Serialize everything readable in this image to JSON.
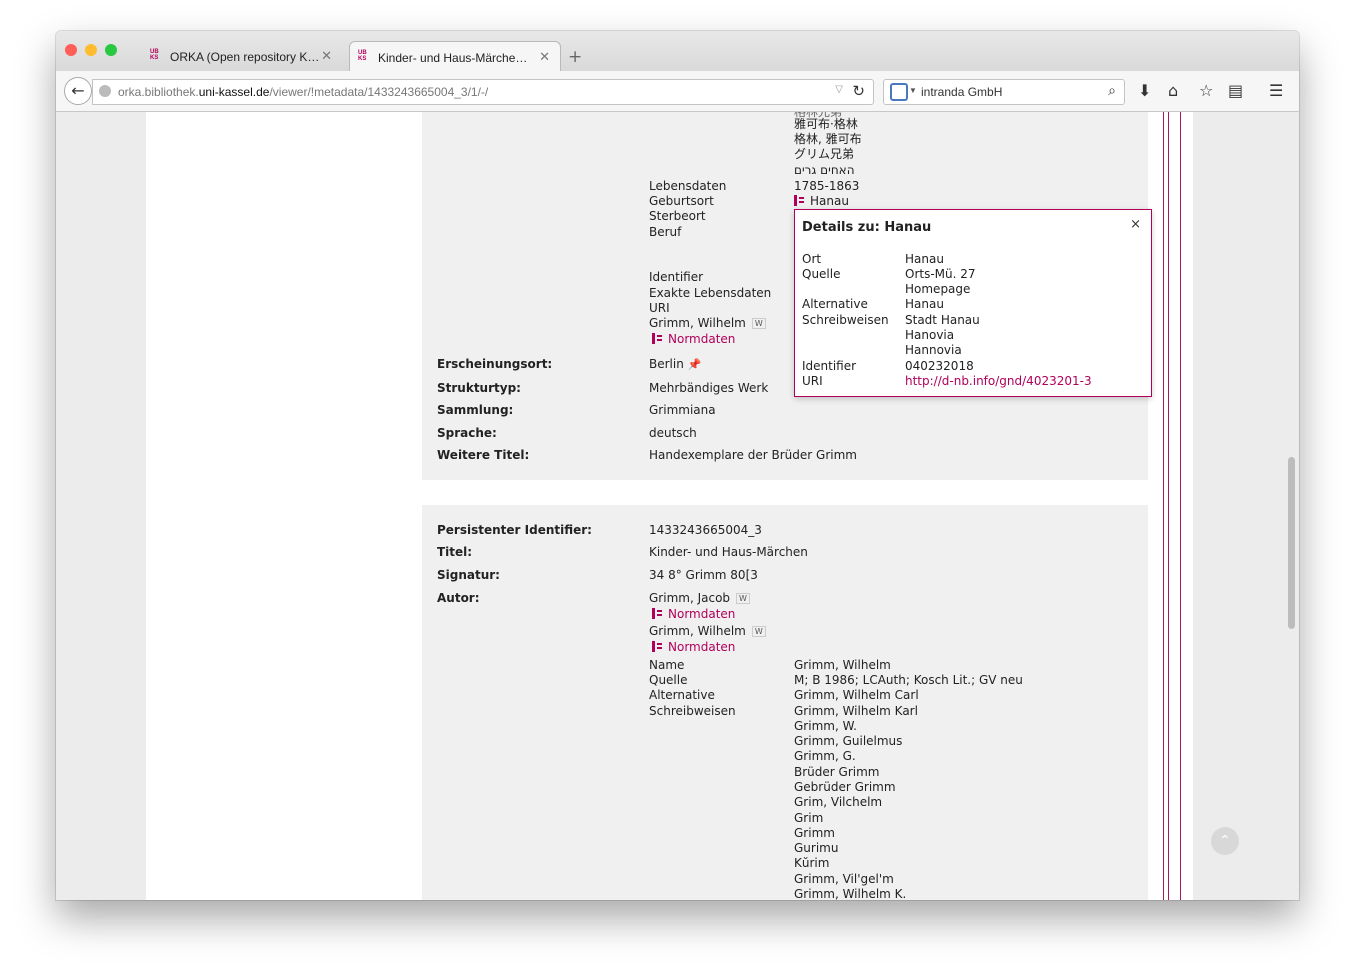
{
  "browser": {
    "tabs": [
      {
        "title": "ORKA (Open repository Kas...",
        "favicon": "ub-kassel-favicon"
      },
      {
        "title": "Kinder- und Haus-Märchen ...",
        "favicon": "ub-kassel-favicon"
      }
    ],
    "url": {
      "prefix": "orka.bibliothek.",
      "host": "uni-kassel.de",
      "path": "/viewer/!metadata/1433243665004_3/1/-/"
    },
    "search": {
      "engine": "intranda GmbH"
    },
    "colors": {
      "close": "#ff5f57",
      "minimize": "#febc2e",
      "zoom": "#28c840"
    }
  },
  "section1": {
    "alt_names_tail": [
      "雅可布·格林",
      "格林, 雅可布",
      "グリム兄弟",
      "האחים גרים"
    ],
    "lebensdaten": {
      "label": "Lebensdaten",
      "value": "1785-1863"
    },
    "geburtsort": {
      "label": "Geburtsort",
      "value": "Hanau"
    },
    "sterbeort_label": "Sterbeort",
    "beruf_label": "Beruf",
    "identifier_label": "Identifier",
    "exakte_label": "Exakte Lebensdaten",
    "uri_label": "URI",
    "person2": "Grimm, Wilhelm",
    "normdaten": "Normdaten",
    "rows": [
      {
        "label": "Erscheinungsort:",
        "value": "Berlin"
      },
      {
        "label": "Strukturtyp:",
        "value": "Mehrbändiges Werk"
      },
      {
        "label": "Sammlung:",
        "value": "Grimmiana"
      },
      {
        "label": "Sprache:",
        "value": "deutsch"
      },
      {
        "label": "Weitere Titel:",
        "value": "Handexemplare der Brüder Grimm"
      }
    ]
  },
  "popup": {
    "title": "Details zu: Hanau",
    "close": "×",
    "ort_label": "Ort",
    "ort": "Hanau",
    "quelle_label": "Quelle",
    "quelle": [
      "Orts-Mü. 27",
      "Homepage"
    ],
    "alt_label": [
      "Alternative",
      "Schreibweisen"
    ],
    "alt": [
      "Hanau",
      "Stadt Hanau",
      "Hanovia",
      "Hannovia"
    ],
    "identifier_label": "Identifier",
    "identifier": "040232018",
    "uri_label": "URI",
    "uri": "http://d-nb.info/gnd/4023201-3"
  },
  "section2": {
    "rows": [
      {
        "label": "Persistenter Identifier:",
        "value": "1433243665004_3"
      },
      {
        "label": "Titel:",
        "value": "Kinder- und Haus-Märchen"
      },
      {
        "label": "Signatur:",
        "value": "34 8° Grimm 80[3"
      }
    ],
    "autor_label": "Autor:",
    "autoren": [
      "Grimm, Jacob",
      "Grimm, Wilhelm"
    ],
    "normdaten": "Normdaten",
    "detail": {
      "name_label": "Name",
      "name": "Grimm, Wilhelm",
      "quelle_label": "Quelle",
      "quelle": "M; B 1986; LCAuth; Kosch Lit.; GV neu",
      "alt_label": [
        "Alternative",
        "Schreibweisen"
      ],
      "alt": [
        "Grimm, Wilhelm Carl",
        "Grimm, Wilhelm Karl",
        "Grimm, W.",
        "Grimm, Guilelmus",
        "Grimm, G.",
        "Brüder Grimm",
        "Gebrüder Grimm",
        "Grim, Vilchelm",
        "Grim",
        "Grimm",
        "Gurimu",
        "Kŭrim",
        "Grimm, Vil'gel'm",
        "Grimm, Wilhelm K."
      ]
    }
  }
}
